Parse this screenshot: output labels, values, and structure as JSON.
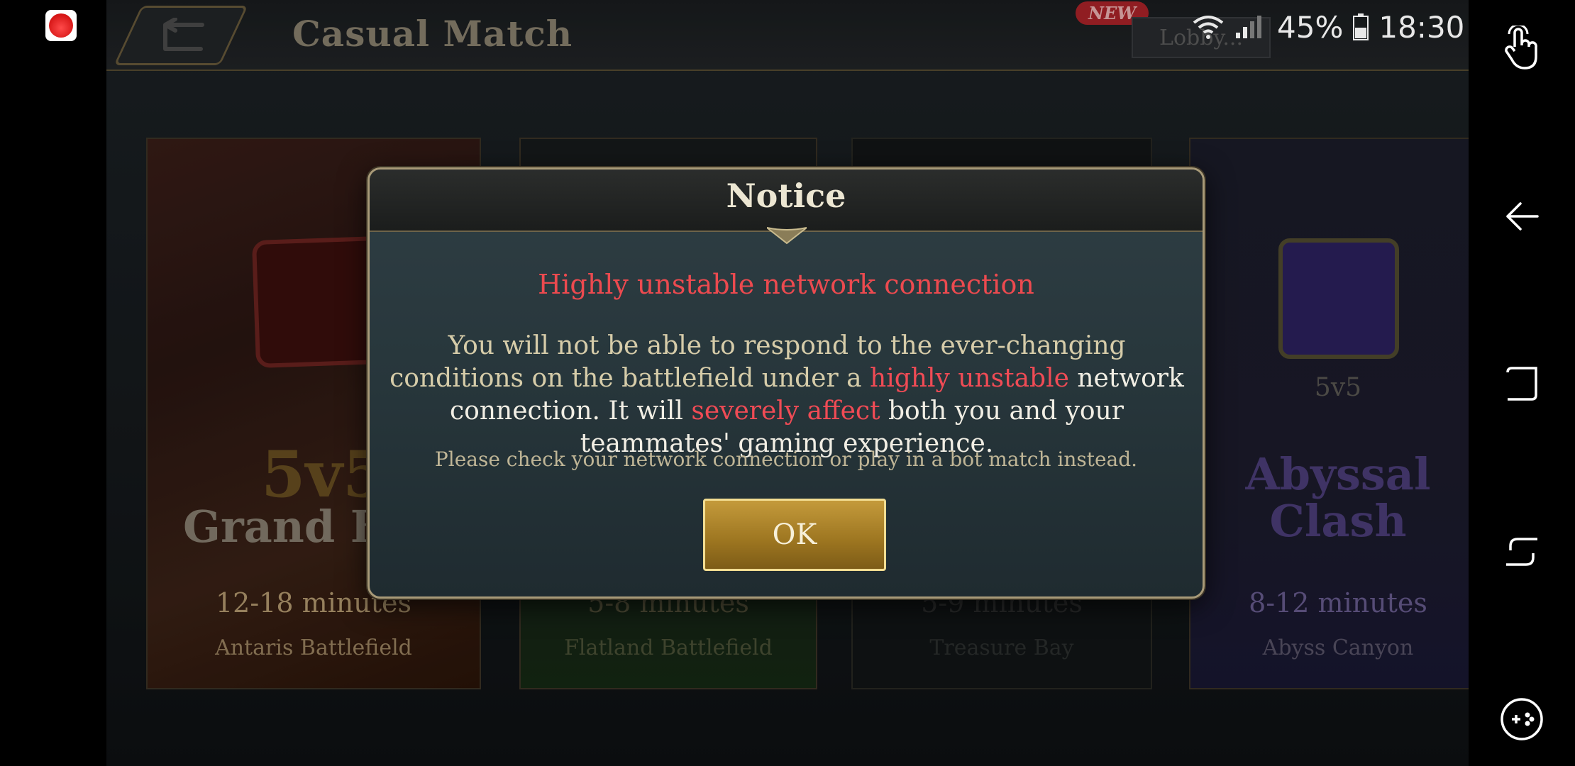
{
  "app": {
    "icon": "antutu-flame-icon"
  },
  "status_bar": {
    "battery_pct": "45%",
    "time": "18:30"
  },
  "header": {
    "title": "Casual Match",
    "new_badge": "NEW",
    "lobby_label": "Lobby..."
  },
  "cards": [
    {
      "mode_big": "5v5",
      "mode_name": "Grand Ba",
      "duration": "12-18 minutes",
      "map": "Antaris Battlefield"
    },
    {
      "duration": "5-8 minutes",
      "map": "Flatland Battlefield"
    },
    {
      "duration": "5-9 minutes",
      "map": "Treasure Bay"
    },
    {
      "vs": "5v5",
      "mode_name_1": "Abyssal",
      "mode_name_2": "Clash",
      "duration": "8-12 minutes",
      "map": "Abyss Canyon"
    }
  ],
  "dialog": {
    "title": "Notice",
    "headline": "Highly unstable network connection",
    "body": {
      "p1": "You will not be able to respond to the ever-changing conditions on the battlefield under a ",
      "hl1": "highly unstable",
      "p2": " network connection. It will ",
      "hl2": "severely affect",
      "p3": " both you and your teammates' gaming experience."
    },
    "hint": "Please check your network connection or play in a bot match instead.",
    "ok_label": "OK"
  },
  "colors": {
    "accent_red": "#ec4a4f",
    "gold": "#c49a3b",
    "dialog_bg": "#2f3e44"
  }
}
